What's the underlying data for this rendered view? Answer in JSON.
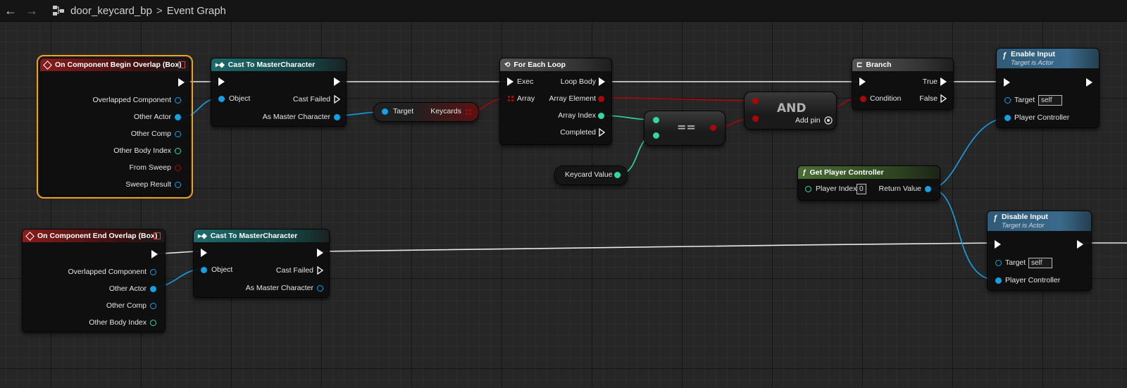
{
  "topbar": {
    "back_icon": "←",
    "forward_icon": "→",
    "blueprint_name": "door_keycard_bp",
    "separator": ">",
    "graph_name": "Event Graph"
  },
  "colors": {
    "exec": "#ffffff",
    "object_pin": "#14a0e6",
    "int_pin": "#30d8a8",
    "bool_pin": "#a80808",
    "selected_outline": "#f0a020"
  },
  "nodes": {
    "begin_overlap": {
      "title": "On Component Begin Overlap (Box)",
      "pins": [
        "Overlapped Component",
        "Other Actor",
        "Other Comp",
        "Other Body Index",
        "From Sweep",
        "Sweep Result"
      ]
    },
    "cast1": {
      "title": "Cast To MasterCharacter",
      "object": "Object",
      "cast_failed": "Cast Failed",
      "as_master": "As Master Character"
    },
    "keycards_get": {
      "target": "Target",
      "keycards": "Keycards"
    },
    "foreach": {
      "title": "For Each Loop",
      "exec": "Exec",
      "loop_body": "Loop Body",
      "array": "Array",
      "array_element": "Array Element",
      "array_index": "Array Index",
      "completed": "Completed"
    },
    "equal": {
      "symbol": "=="
    },
    "keycard_value": {
      "label": "Keycard Value"
    },
    "and_node": {
      "label": "AND",
      "add_pin": "Add pin"
    },
    "branch": {
      "title": "Branch",
      "condition": "Condition",
      "true": "True",
      "false": "False"
    },
    "get_pc": {
      "title": "Get Player Controller",
      "player_index": "Player Index",
      "player_index_value": "0",
      "return_value": "Return Value"
    },
    "enable_input": {
      "title": "Enable Input",
      "subtitle": "Target is Actor",
      "target": "Target",
      "target_value": "self",
      "player_controller": "Player Controller"
    },
    "end_overlap": {
      "title": "On Component End Overlap (Box)",
      "pins": [
        "Overlapped Component",
        "Other Actor",
        "Other Comp",
        "Other Body Index"
      ]
    },
    "cast2": {
      "title": "Cast To MasterCharacter",
      "object": "Object",
      "cast_failed": "Cast Failed",
      "as_master": "As Master Character"
    },
    "disable_input": {
      "title": "Disable Input",
      "subtitle": "Target is Actor",
      "target": "Target",
      "target_value": "self",
      "player_controller": "Player Controller"
    }
  }
}
